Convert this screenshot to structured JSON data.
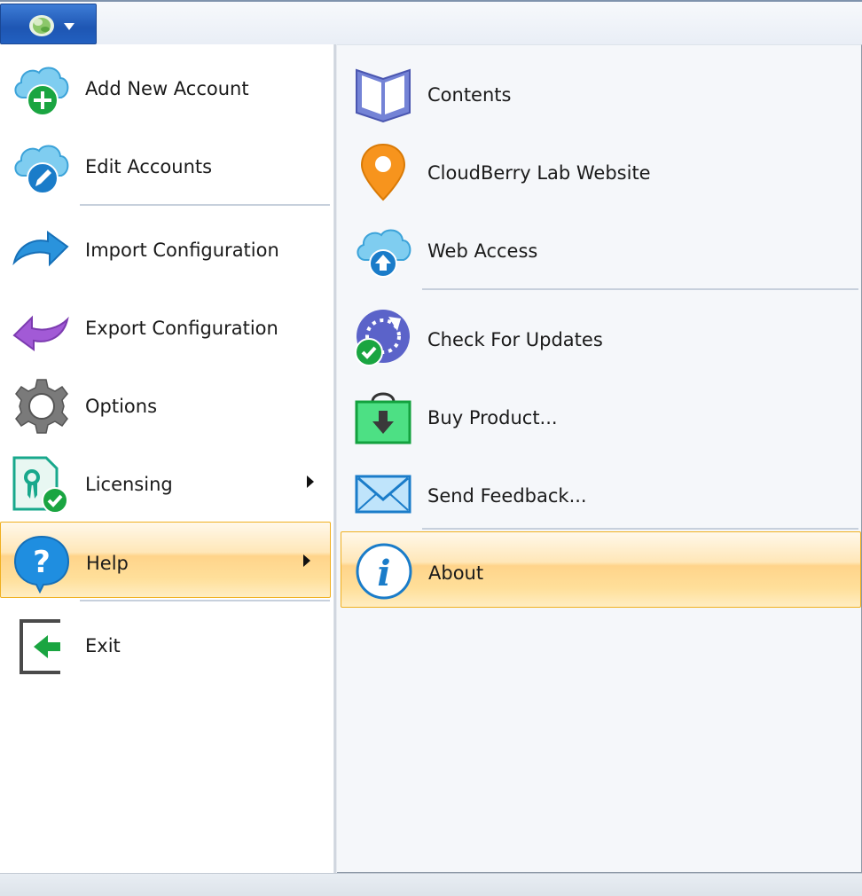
{
  "left_menu": {
    "items": [
      {
        "label": "Add New Account",
        "icon": "cloud-add-icon"
      },
      {
        "label": "Edit Accounts",
        "icon": "cloud-edit-icon"
      },
      {
        "label": "Import Configuration",
        "icon": "import-arrow-icon"
      },
      {
        "label": "Export Configuration",
        "icon": "export-arrow-icon"
      },
      {
        "label": "Options",
        "icon": "gear-icon"
      },
      {
        "label": "Licensing",
        "icon": "certificate-icon",
        "has_submenu": true
      },
      {
        "label": "Help",
        "icon": "help-icon",
        "has_submenu": true,
        "highlighted": true
      },
      {
        "label": "Exit",
        "icon": "exit-icon"
      }
    ]
  },
  "help_submenu": {
    "items": [
      {
        "label": "Contents",
        "icon": "book-icon"
      },
      {
        "label": "CloudBerry Lab Website",
        "icon": "map-pin-icon"
      },
      {
        "label": "Web Access",
        "icon": "cloud-upload-icon"
      },
      {
        "label": "Check For Updates",
        "icon": "update-check-icon"
      },
      {
        "label": "Buy Product...",
        "icon": "shopping-bag-icon"
      },
      {
        "label": "Send Feedback...",
        "icon": "envelope-icon"
      },
      {
        "label": "About",
        "icon": "info-icon",
        "highlighted": true
      }
    ]
  },
  "colors": {
    "accent": "#1e56b3",
    "highlight_border": "#f0b020",
    "highlight_fill": "#ffd48a"
  }
}
